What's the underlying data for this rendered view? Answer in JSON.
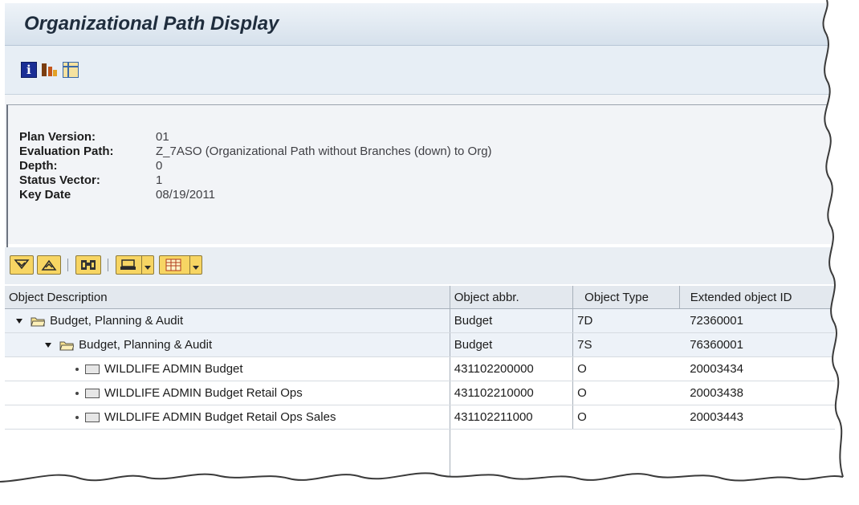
{
  "window": {
    "title": "Organizational Path Display"
  },
  "app_toolbar": {
    "icons": [
      "info-icon",
      "hierarchy-icon",
      "layout-icon"
    ]
  },
  "header": {
    "fields": [
      {
        "label": "Plan Version:",
        "value": "01"
      },
      {
        "label": "Evaluation Path:",
        "value": "Z_7ASO (Organizational Path without Branches (down) to Org)"
      },
      {
        "label": "Depth:",
        "value": "0"
      },
      {
        "label": "Status Vector:",
        "value": "1"
      },
      {
        "label": "Key Date",
        "value": "08/19/2011"
      }
    ]
  },
  "alv_toolbar": {
    "buttons": [
      "expand-icon",
      "collapse-icon",
      "find-icon",
      "print-icon",
      "column-layout-icon"
    ]
  },
  "table": {
    "columns": [
      "Object Description",
      "Object abbr.",
      "Object Type",
      "Extended object ID"
    ],
    "rows": [
      {
        "description": "Budget, Planning & Audit",
        "abbr": "Budget",
        "type": "7D",
        "ext_id": "72360001",
        "node": "folder-open",
        "level": 0
      },
      {
        "description": "Budget, Planning & Audit",
        "abbr": "Budget",
        "type": "7S",
        "ext_id": "76360001",
        "node": "folder-open",
        "level": 1
      },
      {
        "description": "WILDLIFE ADMIN Budget",
        "abbr": "431102200000",
        "type": "O",
        "ext_id": "20003434",
        "node": "leaf",
        "level": 2
      },
      {
        "description": "WILDLIFE ADMIN Budget Retail Ops",
        "abbr": "431102210000",
        "type": "O",
        "ext_id": "20003438",
        "node": "leaf",
        "level": 2
      },
      {
        "description": "WILDLIFE ADMIN Budget Retail Ops Sales",
        "abbr": "431102211000",
        "type": "O",
        "ext_id": "20003443",
        "node": "leaf",
        "level": 2
      }
    ]
  }
}
